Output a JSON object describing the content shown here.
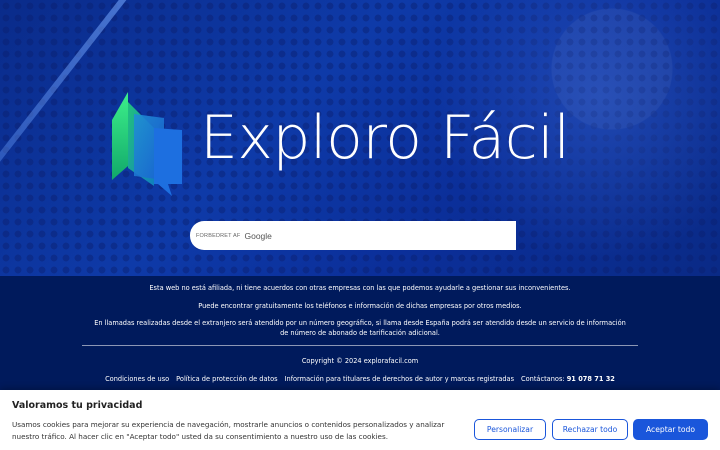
{
  "hero": {
    "brand_name": "Exploro Fácil",
    "logo_icon": "open-book-chat-icon"
  },
  "search": {
    "powered_by": "FORBEDRET AF",
    "provider": "Google"
  },
  "footer": {
    "line1": "Esta web no está afiliada, ni tiene acuerdos con otras empresas con las que podemos ayudarle a gestionar sus inconvenientes.",
    "line2": "Puede encontrar gratuitamente los teléfonos e información de dichas empresas por otros medios.",
    "line3": "En llamadas realizadas desde el extranjero será atendido por un número geográfico, si llama desde España podrá ser atendido desde un servicio de información de número de abonado de tarificación adicional.",
    "copyright": "Copyright © 2024 explorafacil.com",
    "links": {
      "terms": "Condiciones de uso",
      "privacy": "Política de protección de datos",
      "copyright_info": "Información para titulares de derechos de autor y marcas registradas",
      "contact_label": "Contáctanos:",
      "phone": "91 078 71 32"
    }
  },
  "cookie": {
    "title": "Valoramos tu privacidad",
    "text": "Usamos cookies para mejorar su experiencia de navegación, mostrarle anuncios o contenidos personalizados y analizar nuestro tráfico. Al hacer clic en \"Aceptar todo\" usted da su consentimiento a nuestro uso de las cookies.",
    "btn_customize": "Personalizar",
    "btn_reject": "Rechazar todo",
    "btn_accept": "Aceptar todo"
  },
  "colors": {
    "hero_blue": "#0e3aa8",
    "footer_navy": "#001a5c",
    "button_blue": "#1a56db",
    "logo_green": "#2ecc71"
  }
}
